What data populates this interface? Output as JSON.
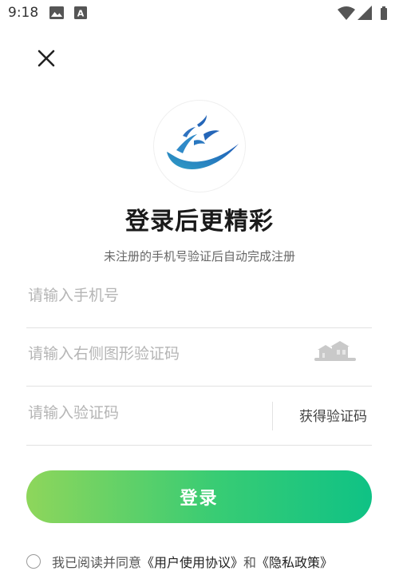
{
  "status_bar": {
    "time": "9:18"
  },
  "header": {
    "title": "登录后更精彩",
    "subtitle": "未注册的手机号验证后自动完成注册"
  },
  "form": {
    "phone_placeholder": "请输入手机号",
    "captcha_placeholder": "请输入右侧图形验证码",
    "code_placeholder": "请输入验证码",
    "get_code_label": "获得验证码"
  },
  "login_button_label": "登录",
  "agreement": {
    "prefix": "我已阅读并同意",
    "user_agreement": "《用户使用协议》",
    "conjunction": "和",
    "privacy_policy": "《隐私政策》",
    "checked": false
  },
  "colors": {
    "accent_start": "#8ed65b",
    "accent_end": "#0fc285",
    "logo_blue": "#2a64b4"
  }
}
